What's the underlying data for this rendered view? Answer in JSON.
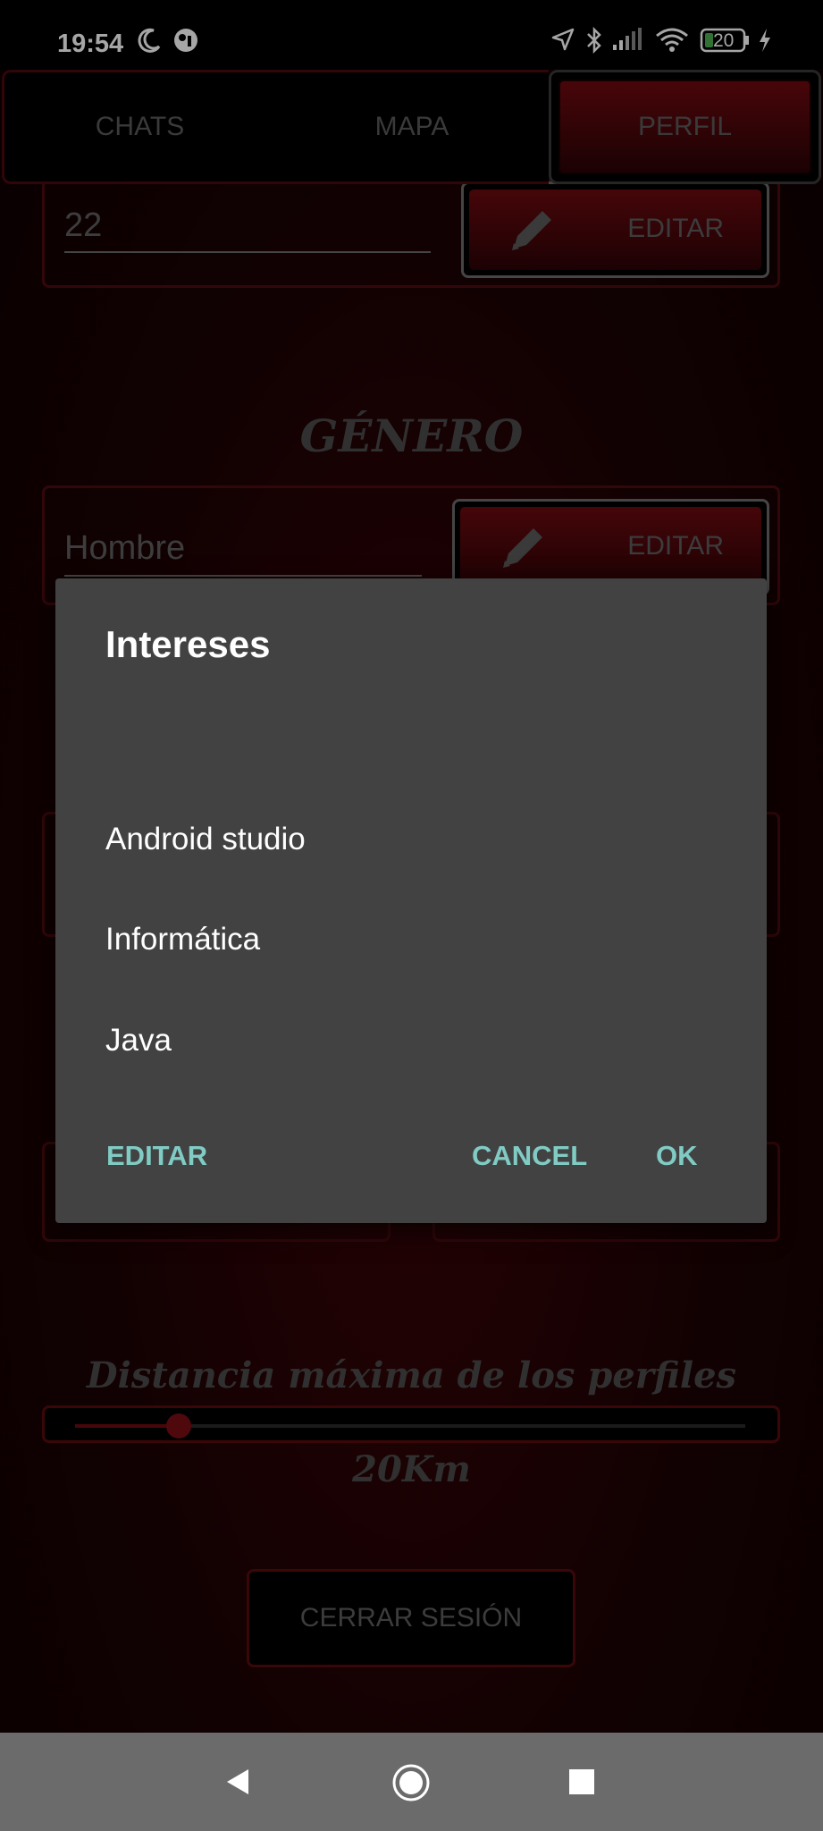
{
  "status_bar": {
    "time": "19:54",
    "battery": "20",
    "icons": [
      "moon-icon",
      "vpn-icon",
      "location-icon",
      "bluetooth-icon",
      "signal-icon",
      "wifi-icon",
      "battery-icon",
      "charging-icon"
    ]
  },
  "tabs": [
    {
      "label": "CHATS",
      "selected": false
    },
    {
      "label": "MAPA",
      "selected": false
    },
    {
      "label": "PERFIL",
      "selected": true
    }
  ],
  "profile": {
    "age_value": "22",
    "edit_label": "EDITAR",
    "gender_title": "GÉNERO",
    "gender_value": "Hombre",
    "distance_title": "Distancia máxima de los perfiles",
    "distance_value": "20Km",
    "distance_fraction": 0.155,
    "logout_label": "CERRAR SESIÓN"
  },
  "dialog": {
    "title": "Intereses",
    "items": [
      "Android studio",
      "Informática",
      "Java"
    ],
    "edit_button": "EDITAR",
    "cancel_button": "CANCEL",
    "ok_button": "OK"
  },
  "colors": {
    "accent": "#80cbc4",
    "dialog_bg": "#424242",
    "brand_red": "#6b0a0f"
  },
  "navigation": [
    "back-icon",
    "home-icon",
    "recents-icon"
  ]
}
